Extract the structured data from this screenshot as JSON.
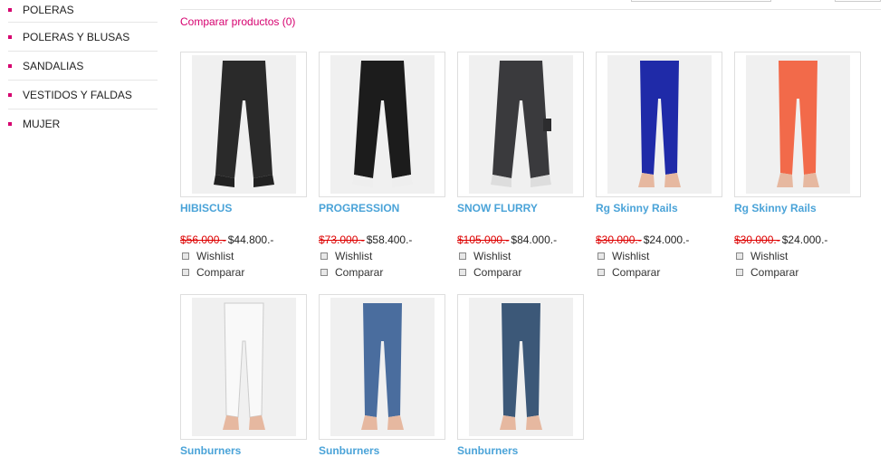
{
  "sidebar": {
    "categories": [
      "POLERAS",
      "POLERAS Y BLUSAS",
      "SANDALIAS",
      "VESTIDOS Y FALDAS",
      "MUJER"
    ]
  },
  "compare_link": "Comparar productos (0)",
  "actions": {
    "wishlist": "Wishlist",
    "compare": "Comparar"
  },
  "products": [
    {
      "name": "HIBISCUS",
      "old_price": "$56.000.-",
      "price": "$44.800.-",
      "color": "#2a2a2a"
    },
    {
      "name": "PROGRESSION",
      "old_price": "$73.000.-",
      "price": "$58.400.-",
      "color": "#1c1c1c"
    },
    {
      "name": "SNOW FLURRY",
      "old_price": "$105.000.-",
      "price": "$84.000.-",
      "color": "#3a3a3d"
    },
    {
      "name": "Rg Skinny Rails",
      "old_price": "$30.000.-",
      "price": "$24.000.-",
      "color": "#1f2aa8"
    },
    {
      "name": "Rg Skinny Rails",
      "old_price": "$30.000.-",
      "price": "$24.000.-",
      "color": "#f26a4a"
    },
    {
      "name": "Sunburners",
      "color": "#f4f4f4"
    },
    {
      "name": "Sunburners",
      "color": "#4a6d9e"
    },
    {
      "name": "Sunburners",
      "color": "#3c5878"
    }
  ],
  "colors": {
    "accent": "#d6006f",
    "link": "#4aa3d8",
    "old_price": "#d00000"
  }
}
